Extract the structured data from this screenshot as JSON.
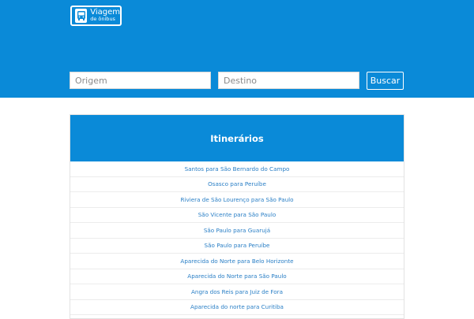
{
  "header": {
    "logo": {
      "line1": "Viagem",
      "line2": "de ônibus",
      "icon": "bus-icon"
    }
  },
  "search": {
    "origin_placeholder": "Origem",
    "destination_placeholder": "Destino",
    "button_label": "Buscar"
  },
  "itineraries": {
    "title": "Itinerários",
    "routes": [
      "Santos para São Bernardo do Campo",
      "Osasco para Peruíbe",
      "Riviera de São Lourenço para São Paulo",
      "São Vicente para São Paulo",
      "São Paulo para Guarujá",
      "São Paulo para Peruíbe",
      "Aparecida do Norte para Belo Horizonte",
      "Aparecida do Norte para São Paulo",
      "Angra dos Reis para Juiz de Fora",
      "Aparecida do norte para Curitiba"
    ]
  },
  "colors": {
    "brand_blue": "#0a8ad8",
    "link_blue": "#2a7fc6"
  }
}
